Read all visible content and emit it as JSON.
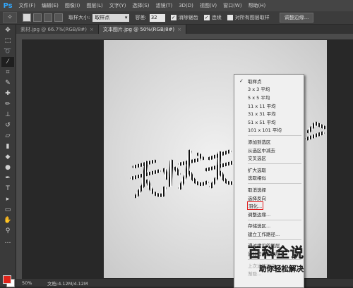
{
  "app": {
    "logo": "Ps"
  },
  "menu": [
    "文件(F)",
    "编辑(E)",
    "图像(I)",
    "图层(L)",
    "文字(Y)",
    "选择(S)",
    "滤镜(T)",
    "3D(D)",
    "视图(V)",
    "窗口(W)",
    "帮助(H)"
  ],
  "options": {
    "sample_size_label": "取样大小:",
    "sample_size_value": "取样点",
    "tolerance_label": "容差:",
    "tolerance_value": "32",
    "antialias_label": "消除锯齿",
    "contiguous_label": "连续",
    "all_layers_label": "对所有图层取样",
    "refine_edge_label": "调整边缘..."
  },
  "tabs": [
    {
      "label": "素材.jpg @ 66.7%(RGB/8#)",
      "close": "×"
    },
    {
      "label": "文本图片.jpg @ 50%(RGB/8#)",
      "close": "×"
    }
  ],
  "status": {
    "zoom": "50%",
    "doc": "文档:4.12M/4.12M"
  },
  "context_menu": {
    "group1": [
      "取样点",
      "3 x 3 平均",
      "5 x 5 平均",
      "11 x 11 平均",
      "31 x 31 平均",
      "51 x 51 平均",
      "101 x 101 平均"
    ],
    "group2": [
      "添加到选区",
      "从选区中减去",
      "交叉选区"
    ],
    "group3": [
      "扩大选取",
      "选取相似"
    ],
    "group4": [
      "取消选择",
      "选择反向",
      "羽化...",
      "调整边缘..."
    ],
    "group5": [
      "存储选区...",
      "建立工作路径..."
    ],
    "group6": [
      "通过拷贝的图层",
      "通过剪切的图层"
    ],
    "group7": [
      "上次滤镜操作",
      "渐隐..."
    ]
  },
  "watermark": {
    "title": "百科全说",
    "subtitle": "助你轻松解决"
  },
  "colors": {
    "foreground": "#e0241b",
    "background": "#ffffff",
    "accent": "#31a8ff"
  }
}
